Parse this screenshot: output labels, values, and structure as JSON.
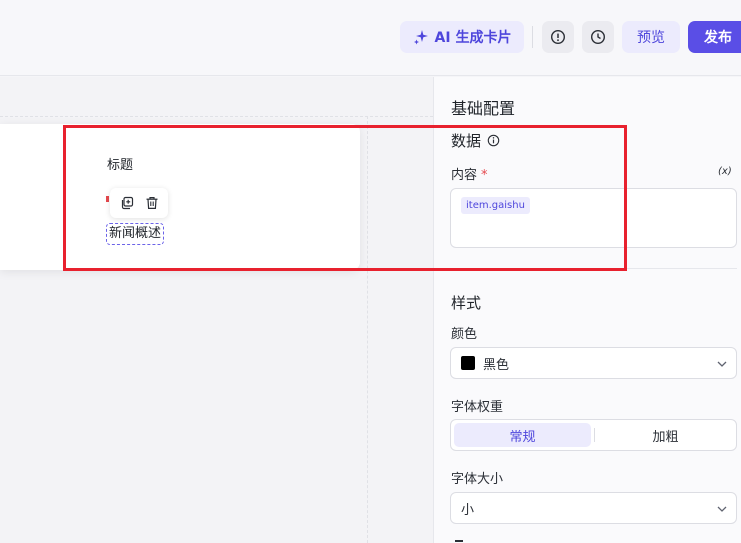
{
  "header": {
    "ai_label": "AI 生成卡片",
    "preview_label": "预览",
    "publish_label": "发布"
  },
  "canvas": {
    "card_title": "标题",
    "selected_text": "新闻概述"
  },
  "panel": {
    "title": "基础配置",
    "data_section": "数据",
    "content_label": "内容",
    "required_mark": "*",
    "fx_label": "(x)",
    "content_tag": "item.gaishu",
    "style_section": "样式",
    "color_label": "颜色",
    "color_value": "黑色",
    "weight_label": "字体权重",
    "weight_options": [
      "常规",
      "加粗"
    ],
    "weight_selected": "常规",
    "size_label": "字体大小",
    "size_value": "小"
  },
  "colors": {
    "accent": "#5a4ee6",
    "accent_soft": "#ecebfd",
    "highlight": "#e8212e",
    "swatch": "#000000"
  },
  "icons": [
    "sparkle-icon",
    "info-icon",
    "history-icon",
    "duplicate-icon",
    "trash-icon",
    "chevron-down-icon"
  ]
}
